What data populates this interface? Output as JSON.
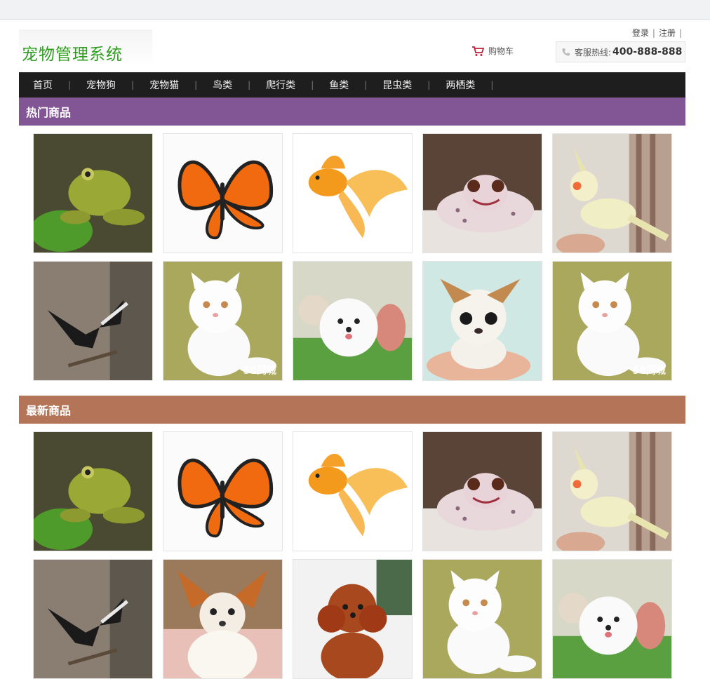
{
  "header": {
    "logo_text": "宠物管理系统",
    "login": "登录",
    "register": "注册",
    "cart": "购物车",
    "hotline_label": "客服热线:",
    "hotline_number": "400-888-888"
  },
  "nav": [
    "首页",
    "宠物狗",
    "宠物猫",
    "鸟类",
    "爬行类",
    "鱼类",
    "昆虫类",
    "两栖类"
  ],
  "colors": {
    "nav_bg": "#1e1e1e",
    "hot_bg": "#825595",
    "new_bg": "#b37458",
    "logo_green": "#2e9e1f"
  },
  "sections": {
    "hot": {
      "title": "热门商品",
      "items": [
        "frog",
        "butterfly",
        "goldfish",
        "gecko",
        "cockatiel",
        "black-bird",
        "white-cat",
        "pomeranian",
        "chihuahua",
        "white-cat"
      ],
      "watermark": "58同城"
    },
    "new": {
      "title": "最新商品",
      "items": [
        "frog",
        "butterfly",
        "goldfish",
        "gecko",
        "cockatiel",
        "black-bird",
        "papillon",
        "poodle",
        "white-cat",
        "pomeranian"
      ]
    }
  }
}
